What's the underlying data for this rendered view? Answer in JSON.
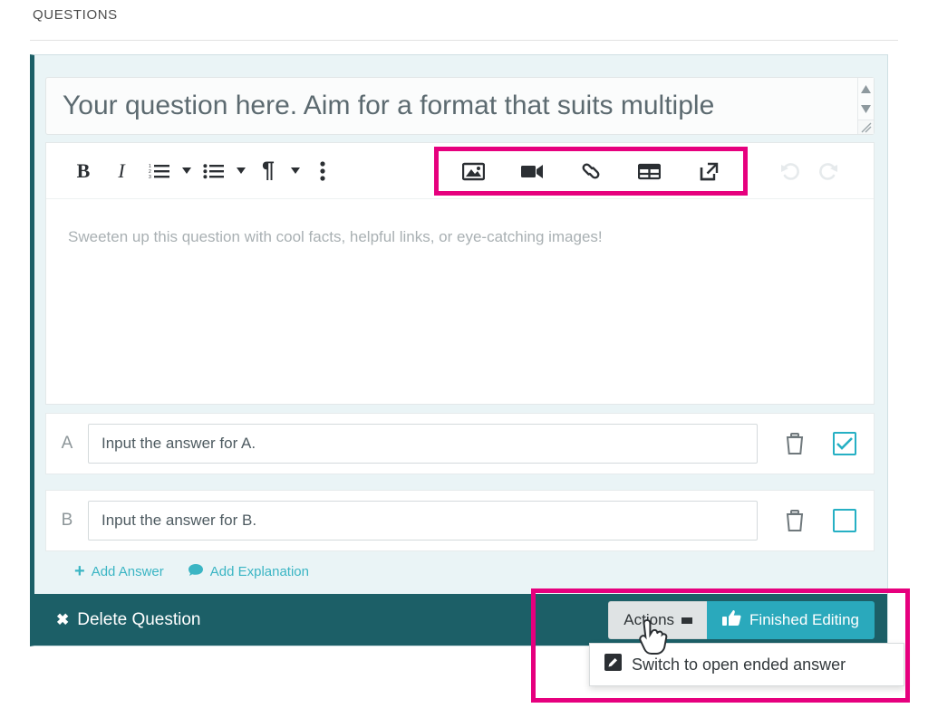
{
  "section": {
    "heading": "QUESTIONS"
  },
  "question_card": {
    "title_input": {
      "value": "Your question here. Aim for a format that suits multiple",
      "placeholder": "Your question here."
    },
    "toolbar": {
      "buttons": [
        {
          "name": "bold-button",
          "label": "B",
          "icon": "bold-icon",
          "disabled": false
        },
        {
          "name": "italic-button",
          "label": "I",
          "icon": "italic-icon",
          "disabled": false
        },
        {
          "name": "ordered-list-button",
          "label": "",
          "icon": "ordered-list-icon",
          "disabled": false
        },
        {
          "name": "unordered-list-button",
          "label": "",
          "icon": "unordered-list-icon",
          "disabled": false
        },
        {
          "name": "paragraph-format-button",
          "label": "¶",
          "icon": "paragraph-icon",
          "disabled": false
        },
        {
          "name": "more-options-button",
          "label": "",
          "icon": "vertical-ellipsis-icon",
          "disabled": false
        }
      ],
      "media_group": {
        "highlighted": true,
        "highlight_color": "#e6007e",
        "buttons": [
          {
            "name": "insert-image-button",
            "icon": "image-icon"
          },
          {
            "name": "insert-video-button",
            "icon": "video-camera-icon"
          },
          {
            "name": "insert-link-button",
            "icon": "link-chain-icon"
          },
          {
            "name": "insert-table-button",
            "icon": "table-icon"
          },
          {
            "name": "insert-embed-button",
            "icon": "external-link-icon"
          }
        ]
      },
      "history": [
        {
          "name": "undo-button",
          "icon": "undo-icon",
          "disabled": true
        },
        {
          "name": "redo-button",
          "icon": "redo-icon",
          "disabled": true
        }
      ]
    },
    "editor_body": {
      "placeholder": "Sweeten up this question with cool facts, helpful links, or eye-catching images!"
    },
    "answers": [
      {
        "letter": "A",
        "placeholder": "Input the answer for A.",
        "value": "",
        "correct": true,
        "delete_icon": "trash-icon"
      },
      {
        "letter": "B",
        "placeholder": "Input the answer for B.",
        "value": "",
        "correct": false,
        "delete_icon": "trash-icon"
      }
    ],
    "add_links": [
      {
        "name": "add-answer-link",
        "label": "Add Answer",
        "icon": "plus-icon"
      },
      {
        "name": "add-explanation-link",
        "label": "Add Explanation",
        "icon": "speech-bubble-icon"
      }
    ],
    "footer": {
      "delete_label": "Delete Question",
      "delete_icon": "close-x-icon",
      "actions_label": "Actions",
      "finished_label": "Finished Editing",
      "finished_icon": "thumbs-up-icon"
    },
    "actions_menu": {
      "highlighted": true,
      "items": [
        {
          "name": "switch-to-open-ended-item",
          "label": "Switch to open ended answer",
          "icon": "edit-pencil-icon"
        }
      ]
    }
  },
  "colors": {
    "highlight": "#e6007e",
    "teal_dark": "#1c5f67",
    "teal_accent": "#2aa9bc",
    "card_bg": "#eaf4f6"
  }
}
